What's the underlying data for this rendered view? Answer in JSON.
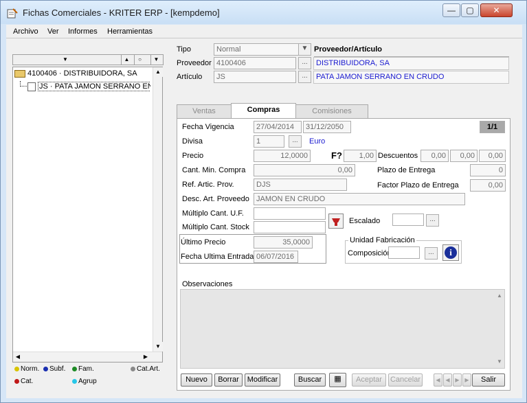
{
  "window": {
    "title": "Fichas Comerciales - KRITER ERP -  [kempdemo]",
    "controls": [
      "minimize-icon",
      "maximize-icon",
      "close-icon"
    ]
  },
  "menu": [
    "Archivo",
    "Ver",
    "Informes",
    "Herramientas"
  ],
  "tree": {
    "root": "4100406 · DISTRIBUIDORA, SA",
    "child": "JS · PATA JAMON SERRANO EN CRUDO"
  },
  "legend": [
    {
      "label": "Norm.",
      "color": "#d8c400"
    },
    {
      "label": "Subf.",
      "color": "#1a2fb0"
    },
    {
      "label": "Fam.",
      "color": "#1d8a25"
    },
    {
      "label": "Cat.Art.",
      "color": "#8a8a8a"
    },
    {
      "label": "Cat.",
      "color": "#c01818"
    },
    {
      "label": "Agrup",
      "color": "#27c7e8"
    }
  ],
  "header": {
    "tipo_label": "Tipo",
    "tipo_value": "Normal",
    "proveedor_label": "Proveedor",
    "proveedor_value": "4100406",
    "articulo_label": "Artículo",
    "articulo_value": "JS",
    "col_header": "Proveedor/Artículo",
    "proveedor_name": "DISTRIBUIDORA, SA",
    "articulo_name": "PATA JAMON SERRANO EN CRUDO"
  },
  "tabs": [
    "Ventas",
    "Compras",
    "Comisiones"
  ],
  "active_tab": "Compras",
  "form": {
    "fecha_vigencia_label": "Fecha Vigencia",
    "fecha_desde": "27/04/2014",
    "fecha_hasta": "31/12/2050",
    "page": "1/1",
    "divisa_label": "Divisa",
    "divisa_value": "1",
    "divisa_name": "Euro",
    "precio_label": "Precio",
    "precio_value": "12,0000",
    "f_label": "F?",
    "f_value": "1,00",
    "descuentos_label": "Descuentos",
    "desc1": "0,00",
    "desc2": "0,00",
    "desc3": "0,00",
    "cant_min_label": "Cant. Min. Compra",
    "cant_min_value": "0,00",
    "plazo_label": "Plazo de Entrega",
    "plazo_value": "0",
    "ref_label": "Ref. Artic. Prov.",
    "ref_value": "DJS",
    "factor_label": "Factor Plazo de Entrega",
    "factor_value": "0,00",
    "desc_art_label": "Desc. Art. Proveedo",
    "desc_art_value": "JAMON EN CRUDO",
    "multiplo_uf_label": "Múltiplo Cant. U.F.",
    "multiplo_stock_label": "Múltiplo Cant. Stock",
    "escalado_label": "Escalado",
    "ultimo_precio_label": "Último Precio",
    "ultimo_precio_value": "35,0000",
    "fecha_entrada_label": "Fecha Ultima Entrada",
    "fecha_entrada_value": "06/07/2016",
    "unidad_label": "Unidad Fabricación",
    "composicion_label": "Composición",
    "observaciones_label": "Observaciones"
  },
  "buttons": {
    "nuevo": "Nuevo",
    "borrar": "Borrar",
    "modificar": "Modificar",
    "buscar": "Buscar",
    "aceptar": "Aceptar",
    "cancelar": "Cancelar",
    "salir": "Salir"
  }
}
